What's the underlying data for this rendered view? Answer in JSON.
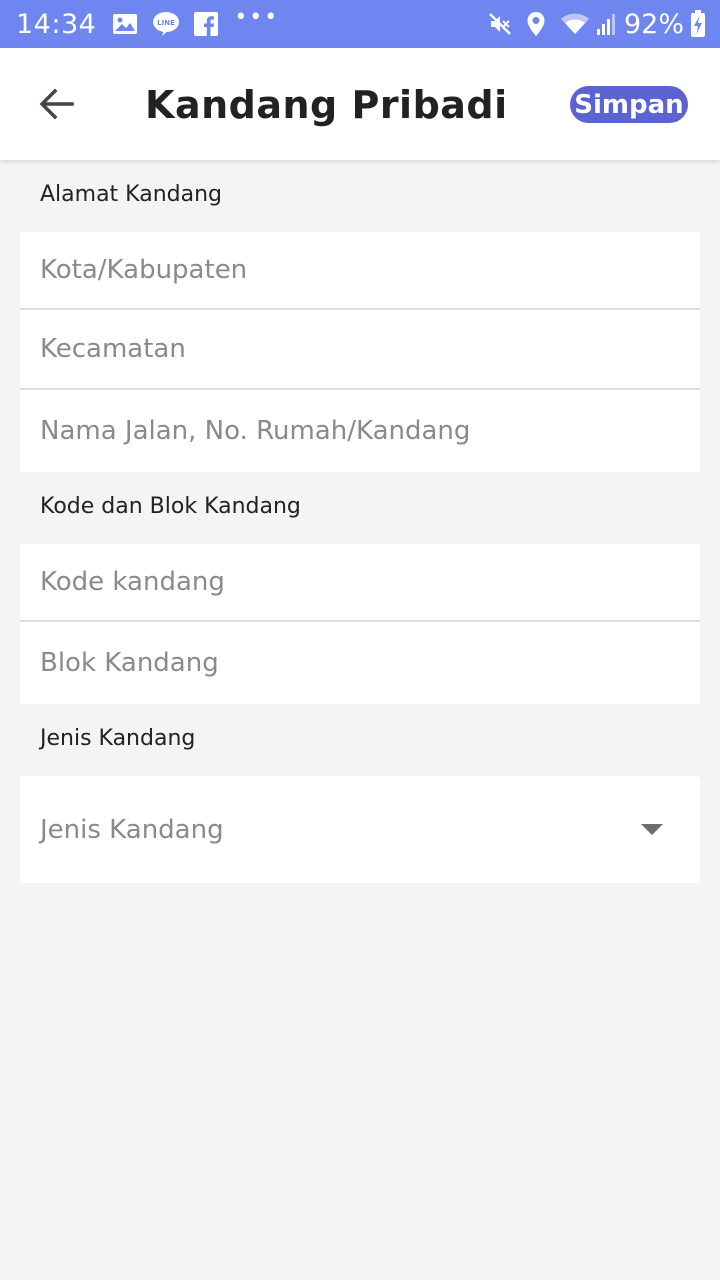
{
  "status_bar": {
    "time": "14:34",
    "battery": "92%",
    "more": "•••",
    "icons": [
      "image-icon",
      "line-icon",
      "facebook-icon",
      "mute-icon",
      "location-icon",
      "wifi-icon",
      "signal-icon",
      "battery-charging-icon"
    ]
  },
  "app_bar": {
    "title": "Kandang Pribadi",
    "save_label": "Simpan",
    "back_icon": "arrow-left-icon",
    "accent_color": "#5b63d3",
    "status_bar_color": "#6f86f0"
  },
  "address_section": {
    "label": "Alamat Kandang",
    "fields": [
      {
        "placeholder": "Kota/Kabupaten",
        "value": ""
      },
      {
        "placeholder": "Kecamatan",
        "value": ""
      },
      {
        "placeholder": "Nama Jalan, No. Rumah/Kandang",
        "value": ""
      }
    ]
  },
  "code_section": {
    "label": "Kode dan Blok Kandang",
    "fields": [
      {
        "placeholder": "Kode kandang",
        "value": ""
      },
      {
        "placeholder": "Blok Kandang",
        "value": ""
      }
    ]
  },
  "type_section": {
    "label": "Jenis Kandang",
    "select_value": "Jenis Kandang",
    "dropdown_icon": "caret-down-icon"
  }
}
